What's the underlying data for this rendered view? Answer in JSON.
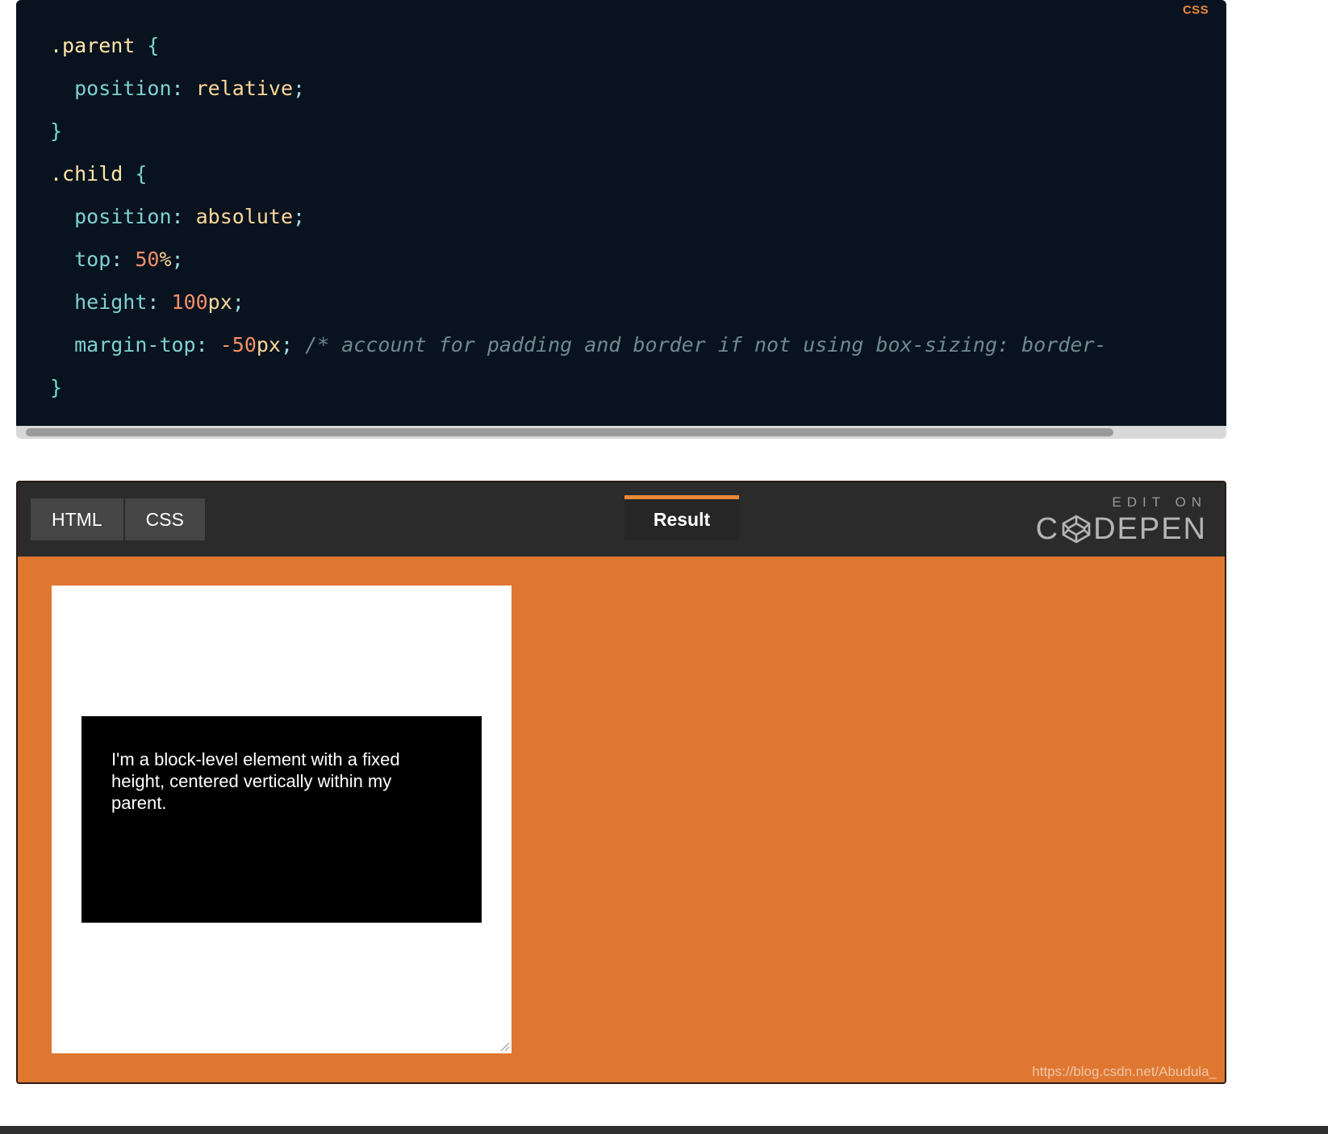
{
  "code_block": {
    "language_badge": "CSS",
    "lines": [
      {
        "indent": 0,
        "tokens": [
          {
            "t": "sel",
            "v": ".parent"
          },
          {
            "t": "plain",
            "v": " "
          },
          {
            "t": "brace",
            "v": "{"
          }
        ]
      },
      {
        "indent": 1,
        "tokens": [
          {
            "t": "prop",
            "v": "position"
          },
          {
            "t": "punc",
            "v": ": "
          },
          {
            "t": "val",
            "v": "relative"
          },
          {
            "t": "punc",
            "v": ";"
          }
        ]
      },
      {
        "indent": 0,
        "tokens": [
          {
            "t": "brace",
            "v": "}"
          }
        ]
      },
      {
        "indent": 0,
        "tokens": [
          {
            "t": "sel",
            "v": ".child"
          },
          {
            "t": "plain",
            "v": " "
          },
          {
            "t": "brace",
            "v": "{"
          }
        ]
      },
      {
        "indent": 1,
        "tokens": [
          {
            "t": "prop",
            "v": "position"
          },
          {
            "t": "punc",
            "v": ": "
          },
          {
            "t": "val",
            "v": "absolute"
          },
          {
            "t": "punc",
            "v": ";"
          }
        ]
      },
      {
        "indent": 1,
        "tokens": [
          {
            "t": "prop",
            "v": "top"
          },
          {
            "t": "punc",
            "v": ": "
          },
          {
            "t": "num",
            "v": "50"
          },
          {
            "t": "unit",
            "v": "%"
          },
          {
            "t": "punc",
            "v": ";"
          }
        ]
      },
      {
        "indent": 1,
        "tokens": [
          {
            "t": "prop",
            "v": "height"
          },
          {
            "t": "punc",
            "v": ": "
          },
          {
            "t": "num",
            "v": "100"
          },
          {
            "t": "unit",
            "v": "px"
          },
          {
            "t": "punc",
            "v": ";"
          }
        ]
      },
      {
        "indent": 1,
        "tokens": [
          {
            "t": "prop",
            "v": "margin-top"
          },
          {
            "t": "punc",
            "v": ": "
          },
          {
            "t": "num",
            "v": "-50"
          },
          {
            "t": "unit",
            "v": "px"
          },
          {
            "t": "punc",
            "v": "; "
          },
          {
            "t": "com",
            "v": "/* account for padding and border if not using box-sizing: border-"
          }
        ]
      },
      {
        "indent": 0,
        "tokens": [
          {
            "t": "brace",
            "v": "}"
          }
        ]
      }
    ],
    "scrollbar": {
      "orientation": "horizontal",
      "thumb_fraction": 0.9
    }
  },
  "codepen": {
    "tabs": [
      {
        "label": "HTML",
        "active": false
      },
      {
        "label": "CSS",
        "active": false
      }
    ],
    "result_tab": {
      "label": "Result",
      "active": true
    },
    "logo": {
      "edit_on": "EDIT ON",
      "name_before": "C",
      "name_after": "DEPEN",
      "icon": "codepen-hexagon-icon"
    },
    "result": {
      "background_color": "#df7731",
      "parent_box_color": "#ffffff",
      "child_box_color": "#000000",
      "child_text": "I'm a block-level element with a fixed height, centered vertically within my parent."
    },
    "watermark": "https://blog.csdn.net/Abudula_"
  },
  "colors": {
    "code_bg": "#08131f",
    "badge_orange": "#f0883e",
    "pen_bar_bg": "#2b2b2b",
    "accent_orange": "#e8883a",
    "result_orange": "#df7731"
  }
}
